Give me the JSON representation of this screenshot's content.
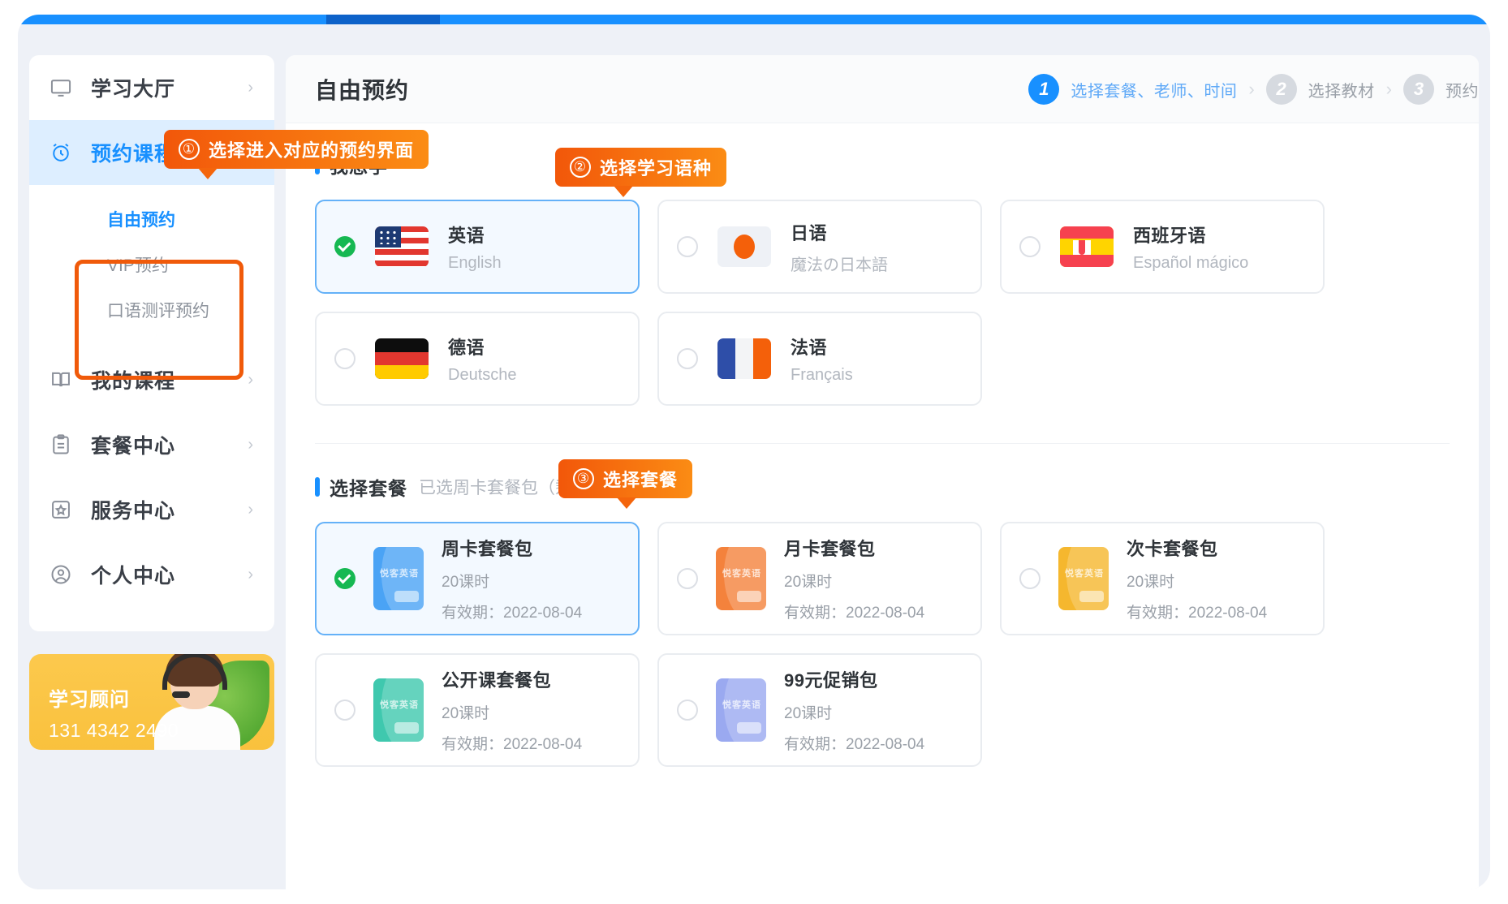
{
  "sidebar": {
    "items": [
      {
        "label": "学习大厅",
        "icon": "monitor-icon",
        "arrow": "›",
        "active": false
      },
      {
        "label": "预约课程",
        "icon": "alarm-clock-icon",
        "arrow": "⌄",
        "active": true
      },
      {
        "label": "我的课程",
        "icon": "book-icon",
        "arrow": "›",
        "active": false
      },
      {
        "label": "套餐中心",
        "icon": "clipboard-icon",
        "arrow": "›",
        "active": false
      },
      {
        "label": "服务中心",
        "icon": "star-badge-icon",
        "arrow": "›",
        "active": false
      },
      {
        "label": "个人中心",
        "icon": "user-circle-icon",
        "arrow": "›",
        "active": false
      }
    ],
    "subitems": [
      {
        "label": "自由预约",
        "active": true
      },
      {
        "label": "VIP预约",
        "active": false
      },
      {
        "label": "口语测评预约",
        "active": false
      }
    ],
    "advisor": {
      "title": "学习顾问",
      "phone": "131 4342 2490"
    }
  },
  "header": {
    "title": "自由预约",
    "steps": [
      {
        "num": "1",
        "label": "选择套餐、老师、时间",
        "active": true
      },
      {
        "num": "2",
        "label": "选择教材",
        "active": false
      },
      {
        "num": "3",
        "label": "预约",
        "active": false
      }
    ],
    "separator": "›"
  },
  "language_section": {
    "title": "我想学",
    "cards": [
      {
        "name": "英语",
        "sub": "English",
        "flag": "flag-us",
        "selected": true
      },
      {
        "name": "日语",
        "sub": "魔法の日本語",
        "flag": "flag-jp",
        "selected": false
      },
      {
        "name": "西班牙语",
        "sub": "Español mágico",
        "flag": "flag-es",
        "selected": false
      },
      {
        "name": "德语",
        "sub": "Deutsche",
        "flag": "flag-de",
        "selected": false
      },
      {
        "name": "法语",
        "sub": "Français",
        "flag": "flag-fr",
        "selected": false
      }
    ]
  },
  "package_section": {
    "title": "选择套餐",
    "sub": "已选周卡套餐包（剩余20课时）",
    "cards": [
      {
        "name": "周卡套餐包",
        "hours": "20课时",
        "validity": "有效期：2022-08-04",
        "brand": "悦客英语",
        "color": "#4aa3f5",
        "selected": true
      },
      {
        "name": "月卡套餐包",
        "hours": "20课时",
        "validity": "有效期：2022-08-04",
        "brand": "悦客英语",
        "color": "#f4823c",
        "selected": false
      },
      {
        "name": "次卡套餐包",
        "hours": "20课时",
        "validity": "有效期：2022-08-04",
        "brand": "悦客英语",
        "color": "#f5b72e",
        "selected": false
      },
      {
        "name": "公开课套餐包",
        "hours": "20课时",
        "validity": "有效期：2022-08-04",
        "brand": "悦客英语",
        "color": "#3fc8ae",
        "selected": false
      },
      {
        "name": "99元促销包",
        "hours": "20课时",
        "validity": "有效期：2022-08-04",
        "brand": "悦客英语",
        "color": "#9aa9f0",
        "selected": false
      }
    ]
  },
  "callouts": [
    {
      "num": "①",
      "text": "选择进入对应的预约界面"
    },
    {
      "num": "②",
      "text": "选择学习语种"
    },
    {
      "num": "③",
      "text": "选择套餐"
    }
  ],
  "colors": {
    "accent_blue": "#1890ff",
    "callout_orange": "#f4650c",
    "check_green": "#16b852",
    "outline_orange": "#f05a0a"
  }
}
